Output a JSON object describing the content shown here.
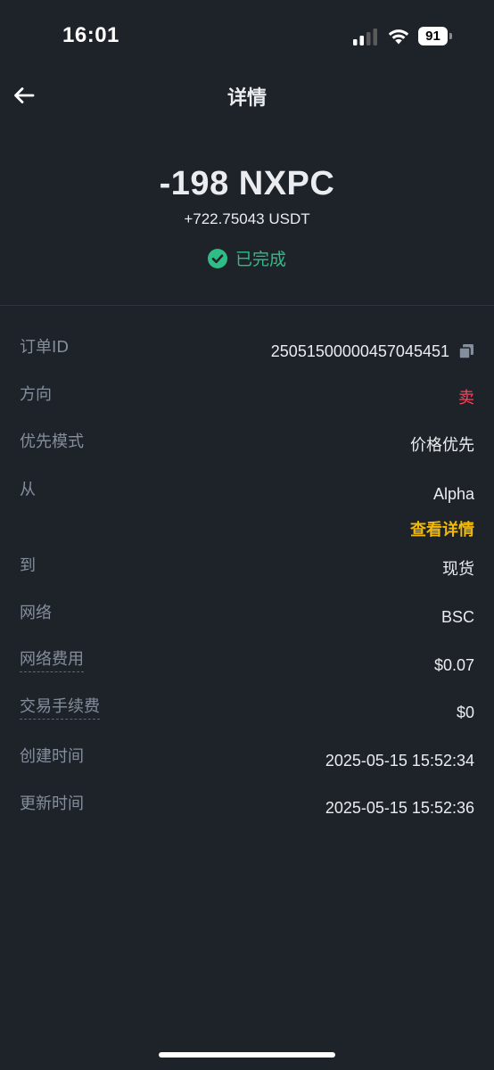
{
  "status_bar": {
    "time": "16:01",
    "battery": "91"
  },
  "header": {
    "title": "详情"
  },
  "summary": {
    "amount": "-198 NXPC",
    "received": "+722.75043 USDT",
    "status": "已完成"
  },
  "details": {
    "order_id_label": "订单ID",
    "order_id_value": "250515000004570454​51",
    "direction_label": "方向",
    "direction_value": "卖",
    "priority_label": "优先模式",
    "priority_value": "价格优先",
    "from_label": "从",
    "from_value": "Alpha",
    "view_details": "查看详情",
    "to_label": "到",
    "to_value": "现货",
    "network_label": "网络",
    "network_value": "BSC",
    "network_fee_label": "网络费用",
    "network_fee_value": "$0.07",
    "trade_fee_label": "交易手续费",
    "trade_fee_value": "$0",
    "created_label": "创建时间",
    "created_value": "2025-05-15 15:52:34",
    "updated_label": "更新时间",
    "updated_value": "2025-05-15 15:52:36"
  },
  "colors": {
    "background": "#1e2329",
    "text": "#eaecef",
    "muted": "#848e9c",
    "success": "#2ebd85",
    "sell": "#f6465d",
    "accent": "#f0b90b"
  },
  "icons": {
    "back": "arrow-left-icon",
    "status": "check-circle-icon",
    "copy": "copy-icon",
    "signal": "cellular-signal-icon",
    "wifi": "wifi-icon",
    "battery": "battery-icon"
  }
}
